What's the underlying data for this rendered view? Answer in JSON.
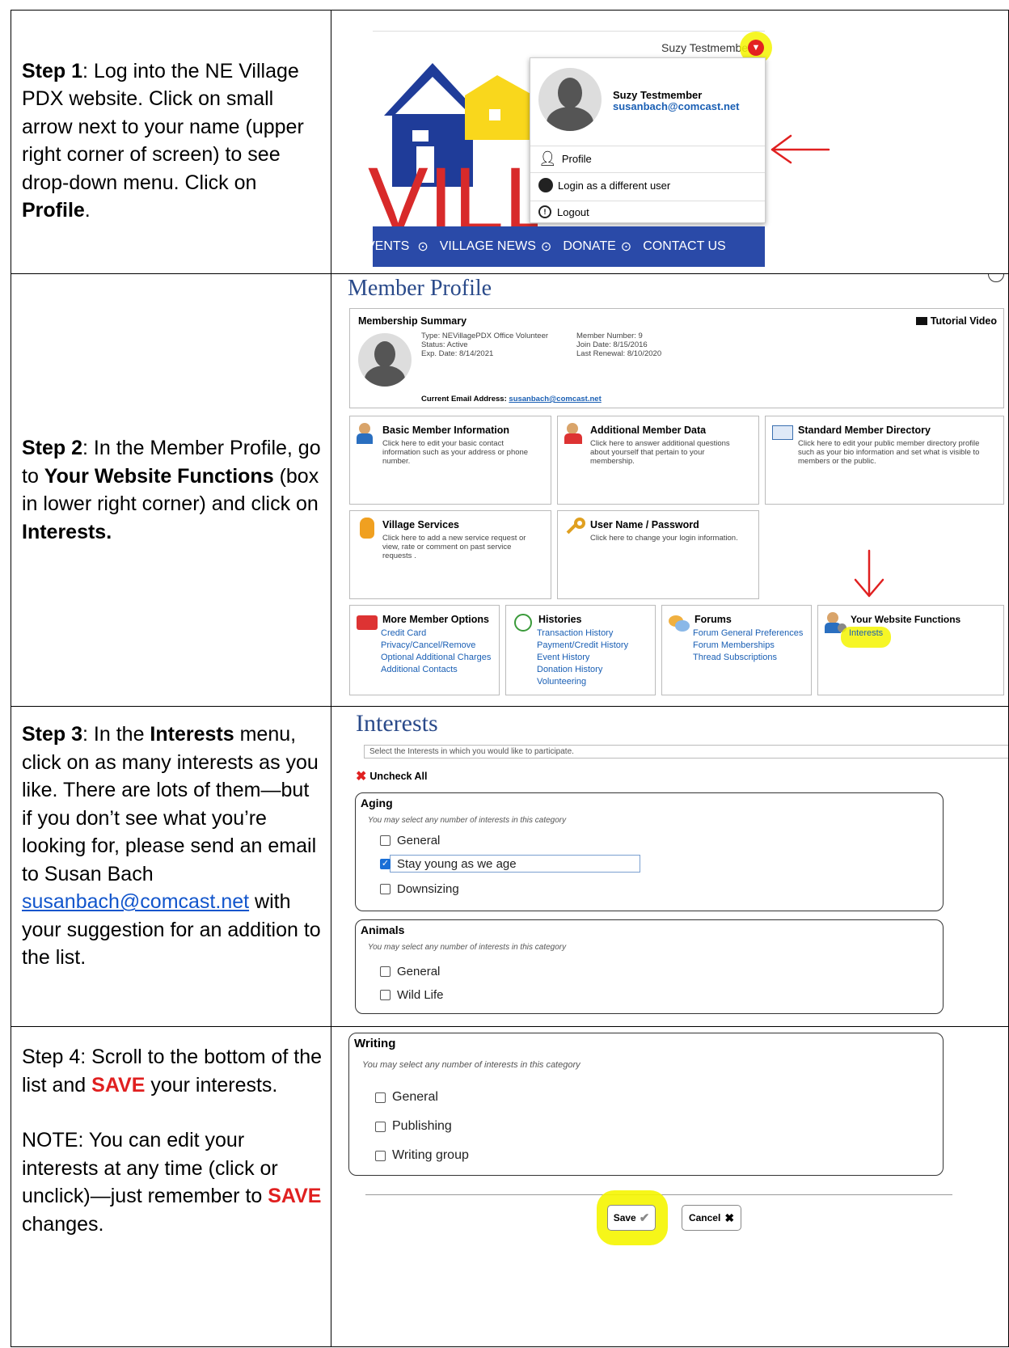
{
  "step1": {
    "label": "Step 1",
    "text1": ":  Log into the NE Village PDX website. Click on small arrow next to your name (upper right corner of screen) to see drop-down menu.  Click on ",
    "bold": "Profile",
    "end": "."
  },
  "step2": {
    "label": "Step 2",
    "text1": ": In the Member Profile, go to ",
    "bold1": "Your Website Functions",
    "text2": " (box in lower right corner) and click on ",
    "bold2": "Interests."
  },
  "step3": {
    "label": "Step 3",
    "text1": ":  In the ",
    "bold1": "Interests",
    "text2": " menu, click on as many interests as you like.  There are lots of them—but if you don’t see what you’re looking for, please send an email to Susan Bach ",
    "link": "susanbach@comcast.net",
    "text3": " with your suggestion for an addition to the list."
  },
  "step4": {
    "text1": "Step 4:  Scroll to the bottom of the list and ",
    "save1": "SAVE",
    "text2": "  your interests.",
    "note1": "NOTE:  You can edit your interests at any time (click or unclick)—just remember to ",
    "save2": "SAVE",
    "note2": " changes."
  },
  "shot1": {
    "username": "Suzy Testmember",
    "dropdown_name": "Suzy Testmember",
    "dropdown_email": "susanbach@comcast.net",
    "menu": [
      "Profile",
      "Login as a different user",
      "Logout"
    ],
    "nav": [
      "VENTS",
      "VILLAGE NEWS",
      "DONATE",
      "CONTACT US"
    ],
    "logo_text": "VILLA"
  },
  "shot2": {
    "title": "Member Profile",
    "summary_title": "Membership Summary",
    "tutorial": "Tutorial Video",
    "type": "Type: NEVillagePDX Office Volunteer",
    "status": "Status: Active",
    "exp": "Exp. Date: 8/14/2021",
    "member_number": "Member Number: 9",
    "join": "Join Date: 8/15/2016",
    "renewal": "Last Renewal: 8/10/2020",
    "email_label": "Current Email Address: ",
    "email": "susanbach@comcast.net",
    "tiles": [
      {
        "title": "Basic Member Information",
        "desc": "Click here to edit your basic contact information such as your address or phone number."
      },
      {
        "title": "Additional Member Data",
        "desc": "Click here to answer additional questions about yourself that pertain to your membership."
      },
      {
        "title": "Standard Member Directory",
        "desc": "Click here to edit your public member directory profile such as your bio information and set what is visible to members or the public."
      },
      {
        "title": "Village Services",
        "desc": "Click here to add a new service request or view, rate or comment on past service requests ."
      },
      {
        "title": "User Name / Password",
        "desc": "Click here to change your login information."
      }
    ],
    "bottom": [
      {
        "title": "More Member Options",
        "links": [
          "Credit Card",
          "Privacy/Cancel/Remove",
          "Optional Additional Charges",
          "Additional Contacts"
        ]
      },
      {
        "title": "Histories",
        "links": [
          "Transaction History",
          "Payment/Credit History",
          "Event History",
          "Donation History",
          "Volunteering"
        ]
      },
      {
        "title": "Forums",
        "links": [
          "Forum General Preferences",
          "Forum Memberships",
          "Thread Subscriptions"
        ]
      },
      {
        "title": "Your Website Functions",
        "links": [
          "Interests"
        ]
      }
    ]
  },
  "shot3": {
    "title": "Interests",
    "prompt": "Select the Interests in which you would like to participate.",
    "uncheck": "Uncheck All",
    "categories": [
      {
        "name": "Aging",
        "sub": "You may select any number of interests in this category",
        "items": [
          "General",
          "Stay young as we age",
          "Downsizing"
        ]
      },
      {
        "name": "Animals",
        "sub": "You may select any number of interests in this category",
        "items": [
          "General",
          "Wild Life"
        ]
      }
    ]
  },
  "shot4": {
    "category": {
      "name": "Writing",
      "sub": "You may select any number of interests in this category",
      "items": [
        "General",
        "Publishing",
        "Writing group"
      ]
    },
    "save": "Save",
    "cancel": "Cancel"
  },
  "colors": {
    "nav_blue": "#2a4aa8",
    "highlight": "#f5f500",
    "annotation_red": "#e02020",
    "link_blue": "#1a5fb4"
  }
}
